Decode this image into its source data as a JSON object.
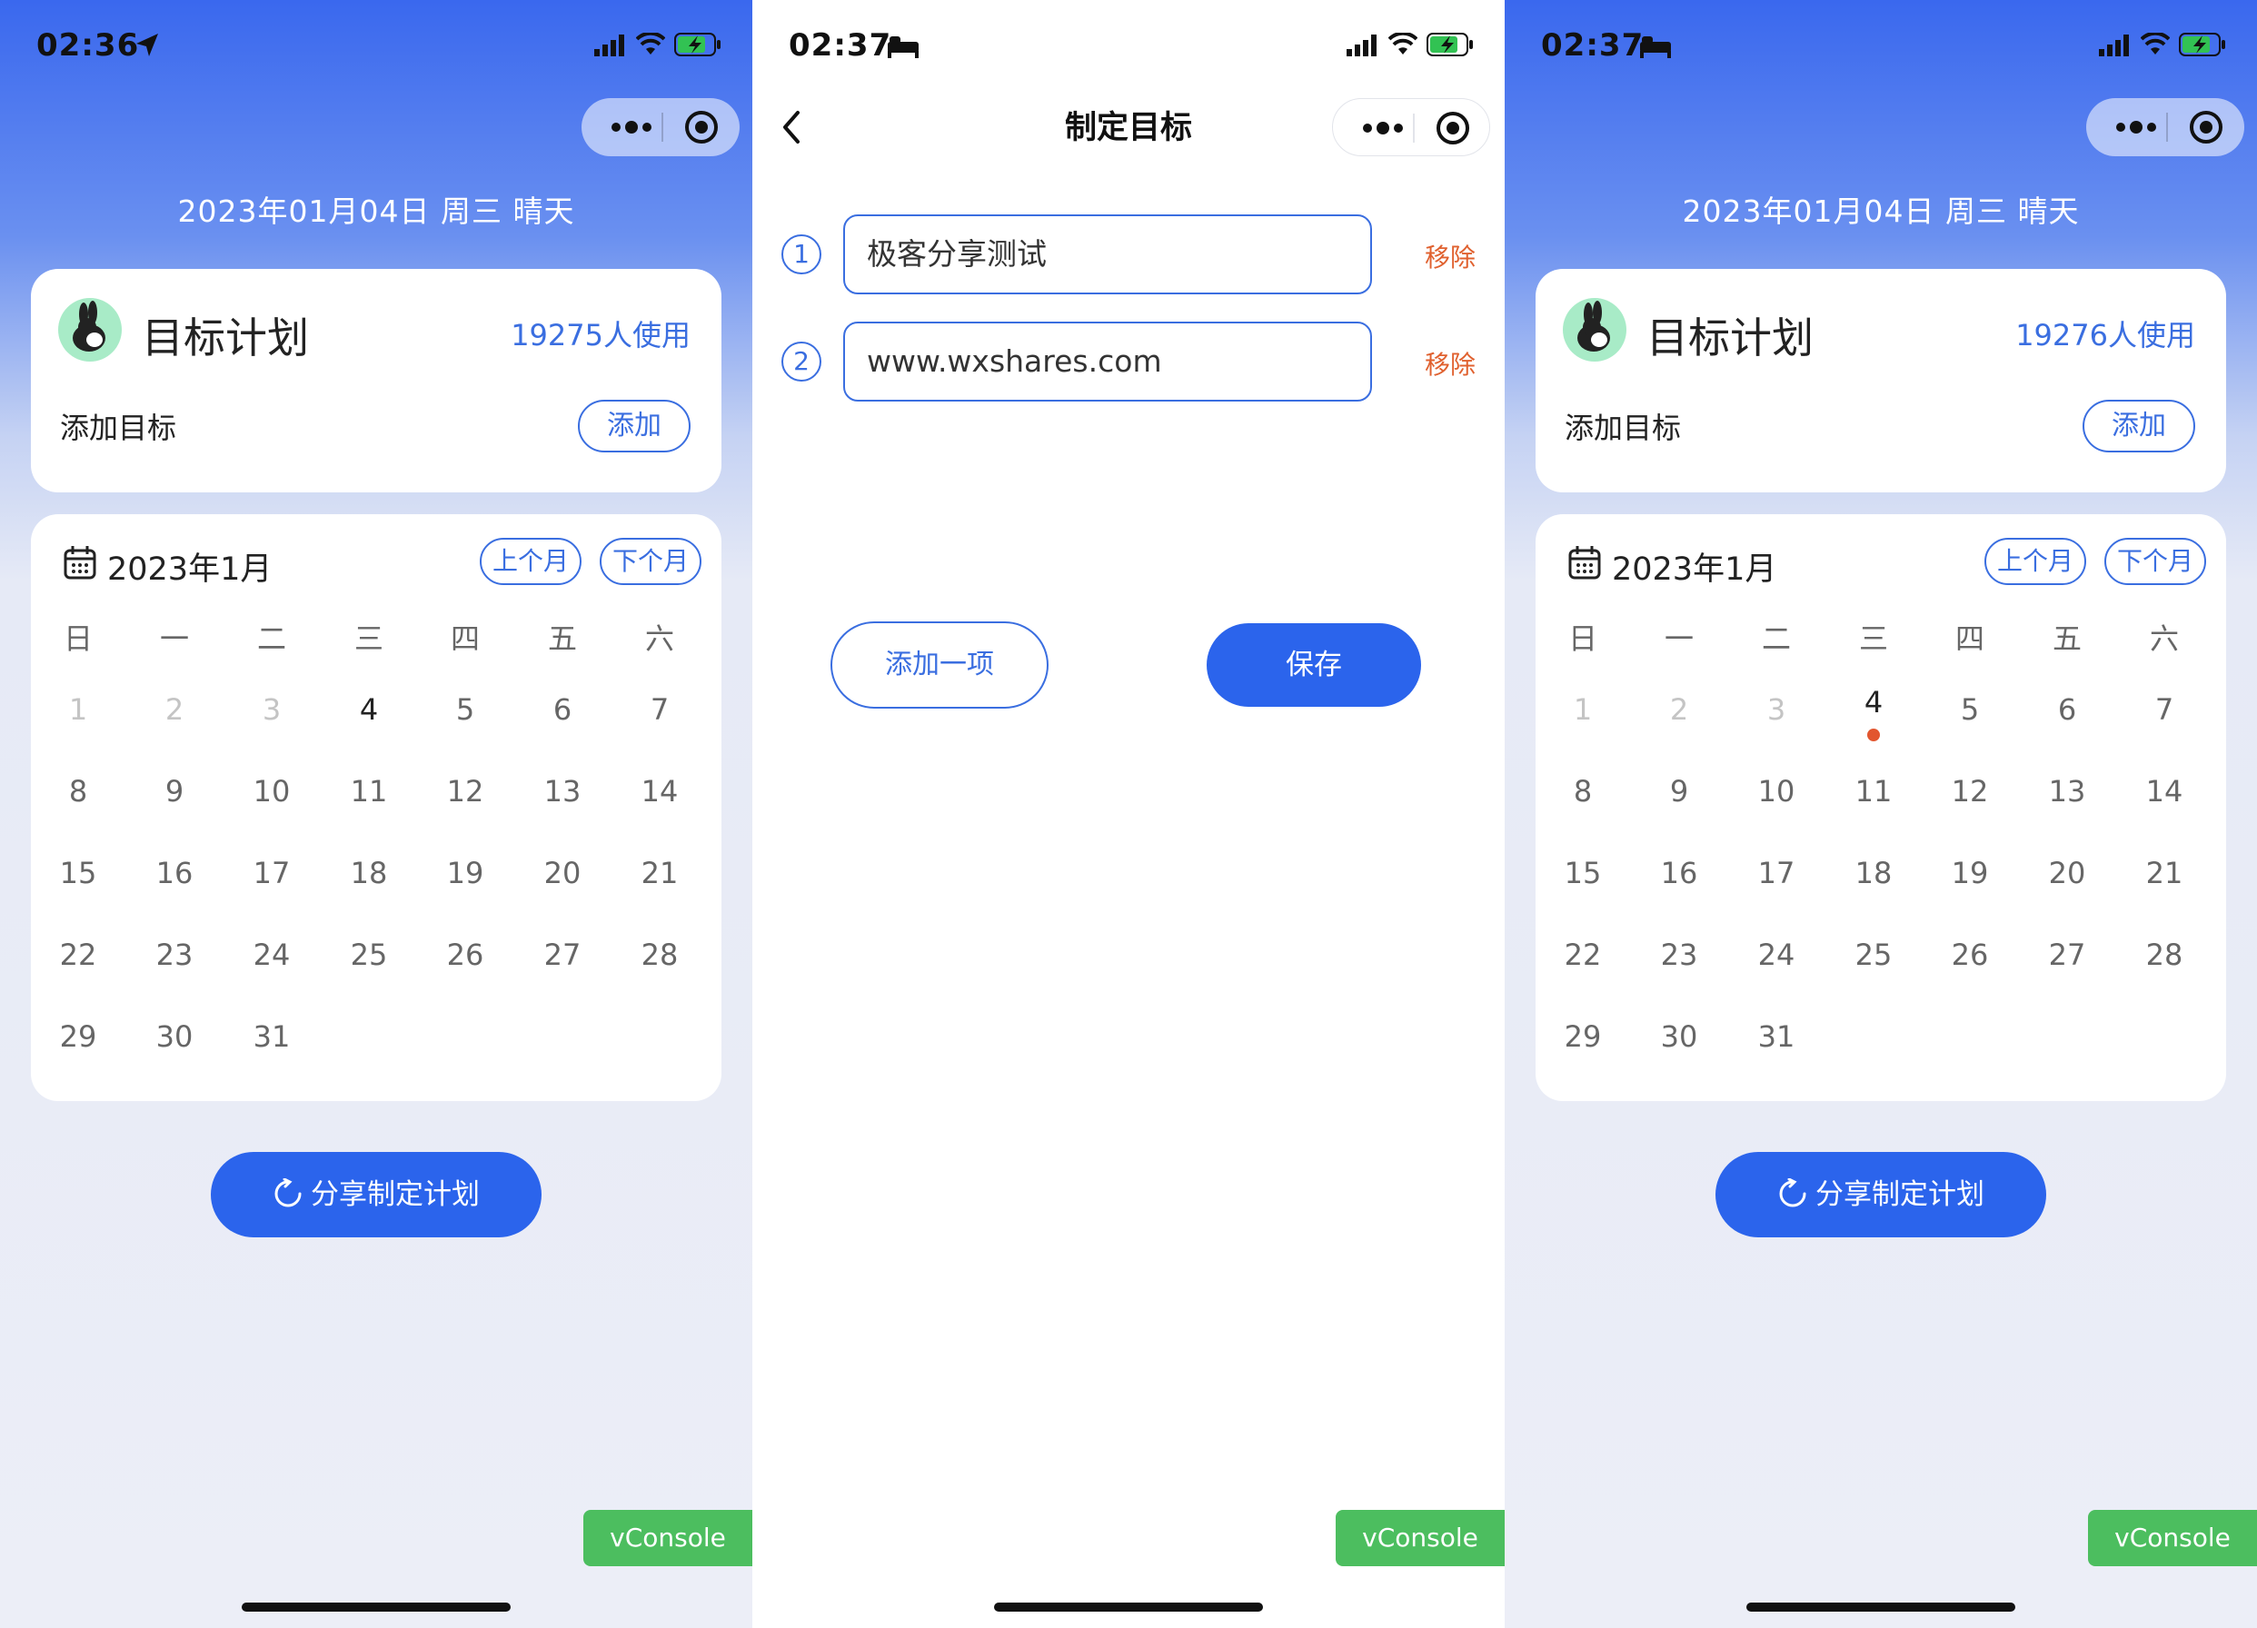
{
  "colors": {
    "accent": "#2b64ec",
    "link": "#3a6ee0",
    "remove": "#e0612f",
    "today_dot": "#e2562f",
    "vconsole": "#4cbe5f",
    "header_gradient_top": "#3a68ee"
  },
  "left": {
    "status": {
      "time": "02:36",
      "extra_icon": "location-arrow-icon"
    },
    "date_line": "2023年01月04日  周三  晴天",
    "plan": {
      "title": "目标计划",
      "users": "19275人使用",
      "add_label": "添加目标",
      "add_button": "添加"
    },
    "calendar": {
      "title": "2023年1月",
      "prev": "上个月",
      "next": "下个月",
      "weekdays": [
        "日",
        "一",
        "二",
        "三",
        "四",
        "五",
        "六"
      ],
      "days": [
        "1",
        "2",
        "3",
        "4",
        "5",
        "6",
        "7",
        "8",
        "9",
        "10",
        "11",
        "12",
        "13",
        "14",
        "15",
        "16",
        "17",
        "18",
        "19",
        "20",
        "21",
        "22",
        "23",
        "24",
        "25",
        "26",
        "27",
        "28",
        "29",
        "30",
        "31"
      ],
      "today": "4",
      "marked_day": null
    },
    "share_button": "分享制定计划",
    "vconsole": "vConsole"
  },
  "middle": {
    "status": {
      "time": "02:37",
      "extra_icon": "bed-icon"
    },
    "nav_title": "制定目标",
    "goals": [
      {
        "num": "1",
        "value": "极客分享测试",
        "remove": "移除"
      },
      {
        "num": "2",
        "value": "www.wxshares.com",
        "remove": "移除"
      }
    ],
    "add_item_button": "添加一项",
    "save_button": "保存",
    "vconsole": "vConsole"
  },
  "right": {
    "status": {
      "time": "02:37",
      "extra_icon": "bed-icon"
    },
    "date_line": "2023年01月04日  周三  晴天",
    "plan": {
      "title": "目标计划",
      "users": "19276人使用",
      "add_label": "添加目标",
      "add_button": "添加"
    },
    "calendar": {
      "title": "2023年1月",
      "prev": "上个月",
      "next": "下个月",
      "weekdays": [
        "日",
        "一",
        "二",
        "三",
        "四",
        "五",
        "六"
      ],
      "days": [
        "1",
        "2",
        "3",
        "4",
        "5",
        "6",
        "7",
        "8",
        "9",
        "10",
        "11",
        "12",
        "13",
        "14",
        "15",
        "16",
        "17",
        "18",
        "19",
        "20",
        "21",
        "22",
        "23",
        "24",
        "25",
        "26",
        "27",
        "28",
        "29",
        "30",
        "31"
      ],
      "today": "4",
      "marked_day": "4"
    },
    "share_button": "分享制定计划",
    "vconsole": "vConsole"
  }
}
